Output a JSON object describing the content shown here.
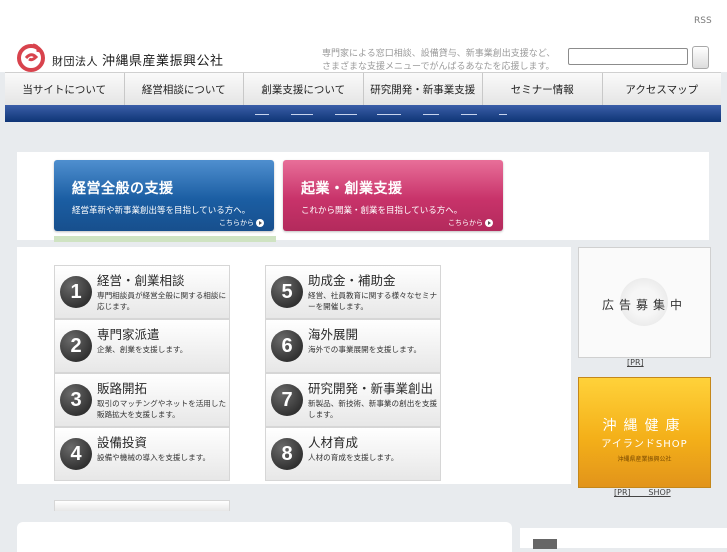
{
  "header": {
    "rss": "RSS",
    "org_prefix": "財団法人",
    "org_name": "沖縄県産業振興公社",
    "tagline": "専門家による窓口相談、設備貸与、新事業創出支援など、さまざまな支援メニューでがんばるあなたを応援します。",
    "search": {
      "value": "",
      "placeholder": ""
    }
  },
  "nav": {
    "items": [
      {
        "label": "当サイトについて"
      },
      {
        "label": "経営相談について"
      },
      {
        "label": "創業支援について"
      },
      {
        "label": "研究開発・新事業支援"
      },
      {
        "label": "セミナー情報"
      },
      {
        "label": "アクセスマップ"
      }
    ]
  },
  "banners": [
    {
      "title": "経営全般の支援",
      "desc": "経営革新や新事業創出等を目指している方へ。",
      "more": "こちらから",
      "color": "#1b5ea3"
    },
    {
      "title": "起業・創業支援",
      "desc": "これから開業・創業を目指している方へ。",
      "more": "こちらから",
      "color": "#c8336a"
    }
  ],
  "services": [
    {
      "num": "1",
      "title": "経営・創業相談",
      "desc": "専門相談員が経営全般に関する相談に応じます。"
    },
    {
      "num": "2",
      "title": "専門家派遣",
      "desc": "企業、創業を支援します。"
    },
    {
      "num": "3",
      "title": "販路開拓",
      "desc": "取引のマッチングやネットを活用した販路拡大を支援します。"
    },
    {
      "num": "4",
      "title": "設備投資",
      "desc": "設備や機械の導入を支援します。"
    },
    {
      "num": "5",
      "title": "助成金・補助金",
      "desc": "経営、社員教育に関する様々なセミナーを開催します。"
    },
    {
      "num": "6",
      "title": "海外展開",
      "desc": "海外での事業展開を支援します。"
    },
    {
      "num": "7",
      "title": "研究開発・新事業創出",
      "desc": "新製品、新技術、新事業の創出を支援します。"
    },
    {
      "num": "8",
      "title": "人材育成",
      "desc": "人材の育成を支援します。"
    }
  ],
  "ads": {
    "ad1_text": "広告募集中",
    "pr1": "[PR]",
    "shop_title": "沖縄健康",
    "shop_sub": "アイランドSHOP",
    "shop_org": "沖縄県産業振興公社",
    "pr2": "[PR]       SHOP"
  },
  "colors": {
    "nav_bar": "#0e3576",
    "banner_blue": "#1b5ea3",
    "banner_pink": "#c8336a",
    "shop_gold": "#f4b019"
  }
}
